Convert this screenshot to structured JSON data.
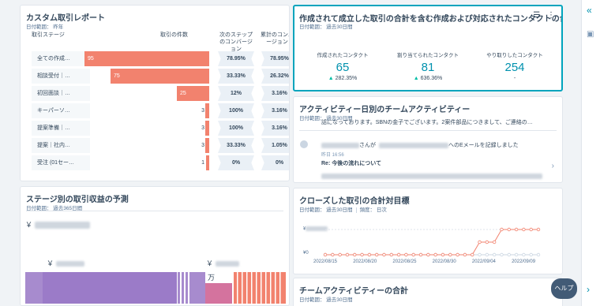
{
  "card_funnel": {
    "title": "カスタム取引レポート",
    "date_range": "日付範囲： 昨年",
    "headers": {
      "stage": "取引ステージ",
      "count": "取引の件数",
      "next_conv": "次のステップのコンバージョン",
      "cum_conv": "累計のコンバージョン"
    },
    "rows": [
      {
        "stage": "全ての作成…",
        "bar_value": "95",
        "count": "",
        "next": "78.95%",
        "cum": "78.95%",
        "fraction": 1.0,
        "color": "#f2826e"
      },
      {
        "stage": "相談受付｜…",
        "bar_value": "75",
        "count": "",
        "next": "33.33%",
        "cum": "26.32%",
        "fraction": 0.79,
        "color": "#f2826e"
      },
      {
        "stage": "初回面談｜…",
        "bar_value": "25",
        "count": "",
        "next": "12%",
        "cum": "3.16%",
        "fraction": 0.26,
        "color": "#f2826e"
      },
      {
        "stage": "キーパーソ…",
        "bar_value": "",
        "count": "3",
        "next": "100%",
        "cum": "3.16%",
        "fraction": 0.03,
        "color": "#f2826e"
      },
      {
        "stage": "提案準備｜…",
        "bar_value": "",
        "count": "3",
        "next": "100%",
        "cum": "3.16%",
        "fraction": 0.03,
        "color": "#f2826e"
      },
      {
        "stage": "提案｜社内…",
        "bar_value": "",
        "count": "3",
        "next": "33.33%",
        "cum": "1.05%",
        "fraction": 0.03,
        "color": "#f2826e"
      },
      {
        "stage": "受注 (01セー…",
        "bar_value": "",
        "count": "1",
        "next": "0%",
        "cum": "0%",
        "fraction": 0.01,
        "color": "#f2826e"
      }
    ]
  },
  "card_metrics": {
    "title": "作成されて成立した取引の合計を含む作成および対応されたコンタクトの合計",
    "date_range": "日付範囲： 過去30日間",
    "icons": [
      "filter-icon",
      "more-icon"
    ],
    "metrics": [
      {
        "label": "作成されたコンタクト",
        "value": "65",
        "delta": "282.35%"
      },
      {
        "label": "割り当てられたコンタクト",
        "value": "81",
        "delta": "636.36%"
      },
      {
        "label": "やり取りしたコンタクト",
        "value": "254",
        "delta": "-"
      }
    ]
  },
  "card_activity": {
    "title": "アクティビティー日別のチームアクティビティー",
    "date_range": "日付範囲： 過去30日間",
    "preview_text": "話になっております。SBNの金子でございます。2案件部品につきまして、ご連絡の…",
    "who_suffix": "さんが",
    "who_action": "へのEメールを記録しました",
    "time": "昨日 16:56",
    "subject": "Re: 今後の流れについて"
  },
  "card_forecast": {
    "title": "ステージ別の取引収益の予測",
    "date_range": "日付範囲： 過去365日間",
    "yen_symbol": "￥",
    "man_label": "万"
  },
  "card_closed": {
    "title": "クローズした取引の合計対目標",
    "date_range": "日付範囲： 過去30日間",
    "frequency": "頻度： 日次",
    "y_zero": "¥0",
    "yen_symbol": "¥"
  },
  "card_team": {
    "title": "チームアクティビティーの合計",
    "date_range": "日付範囲： 過去30日間"
  },
  "chart_data": {
    "type": "line",
    "title": "クローズした取引の合計対目標",
    "x_labels": [
      "2022/08/15",
      "2022/08/20",
      "2022/08/25",
      "2022/08/30",
      "2022/09/04",
      "2022/09/09"
    ],
    "series": [
      {
        "values": [
          0,
          0,
          0,
          0,
          0,
          0,
          0,
          0,
          0,
          0,
          0,
          0,
          0,
          0,
          0,
          0,
          0,
          0,
          0,
          0,
          0,
          1,
          1,
          1,
          2,
          2,
          2,
          2,
          2,
          2
        ],
        "color": "#f2826e"
      },
      {
        "values": [
          0,
          0,
          0,
          0,
          0,
          0,
          0,
          0,
          0,
          0,
          0,
          0,
          0,
          0,
          0,
          0,
          0,
          0,
          0,
          0,
          0,
          0,
          0,
          0,
          0,
          0,
          0,
          0,
          0,
          0
        ],
        "color": "#cbd6e2"
      }
    ]
  },
  "rail": {
    "collapse_icon": "«",
    "chat_icon": "▣",
    "expand_icon": "›"
  },
  "help_label": "ヘルプ"
}
